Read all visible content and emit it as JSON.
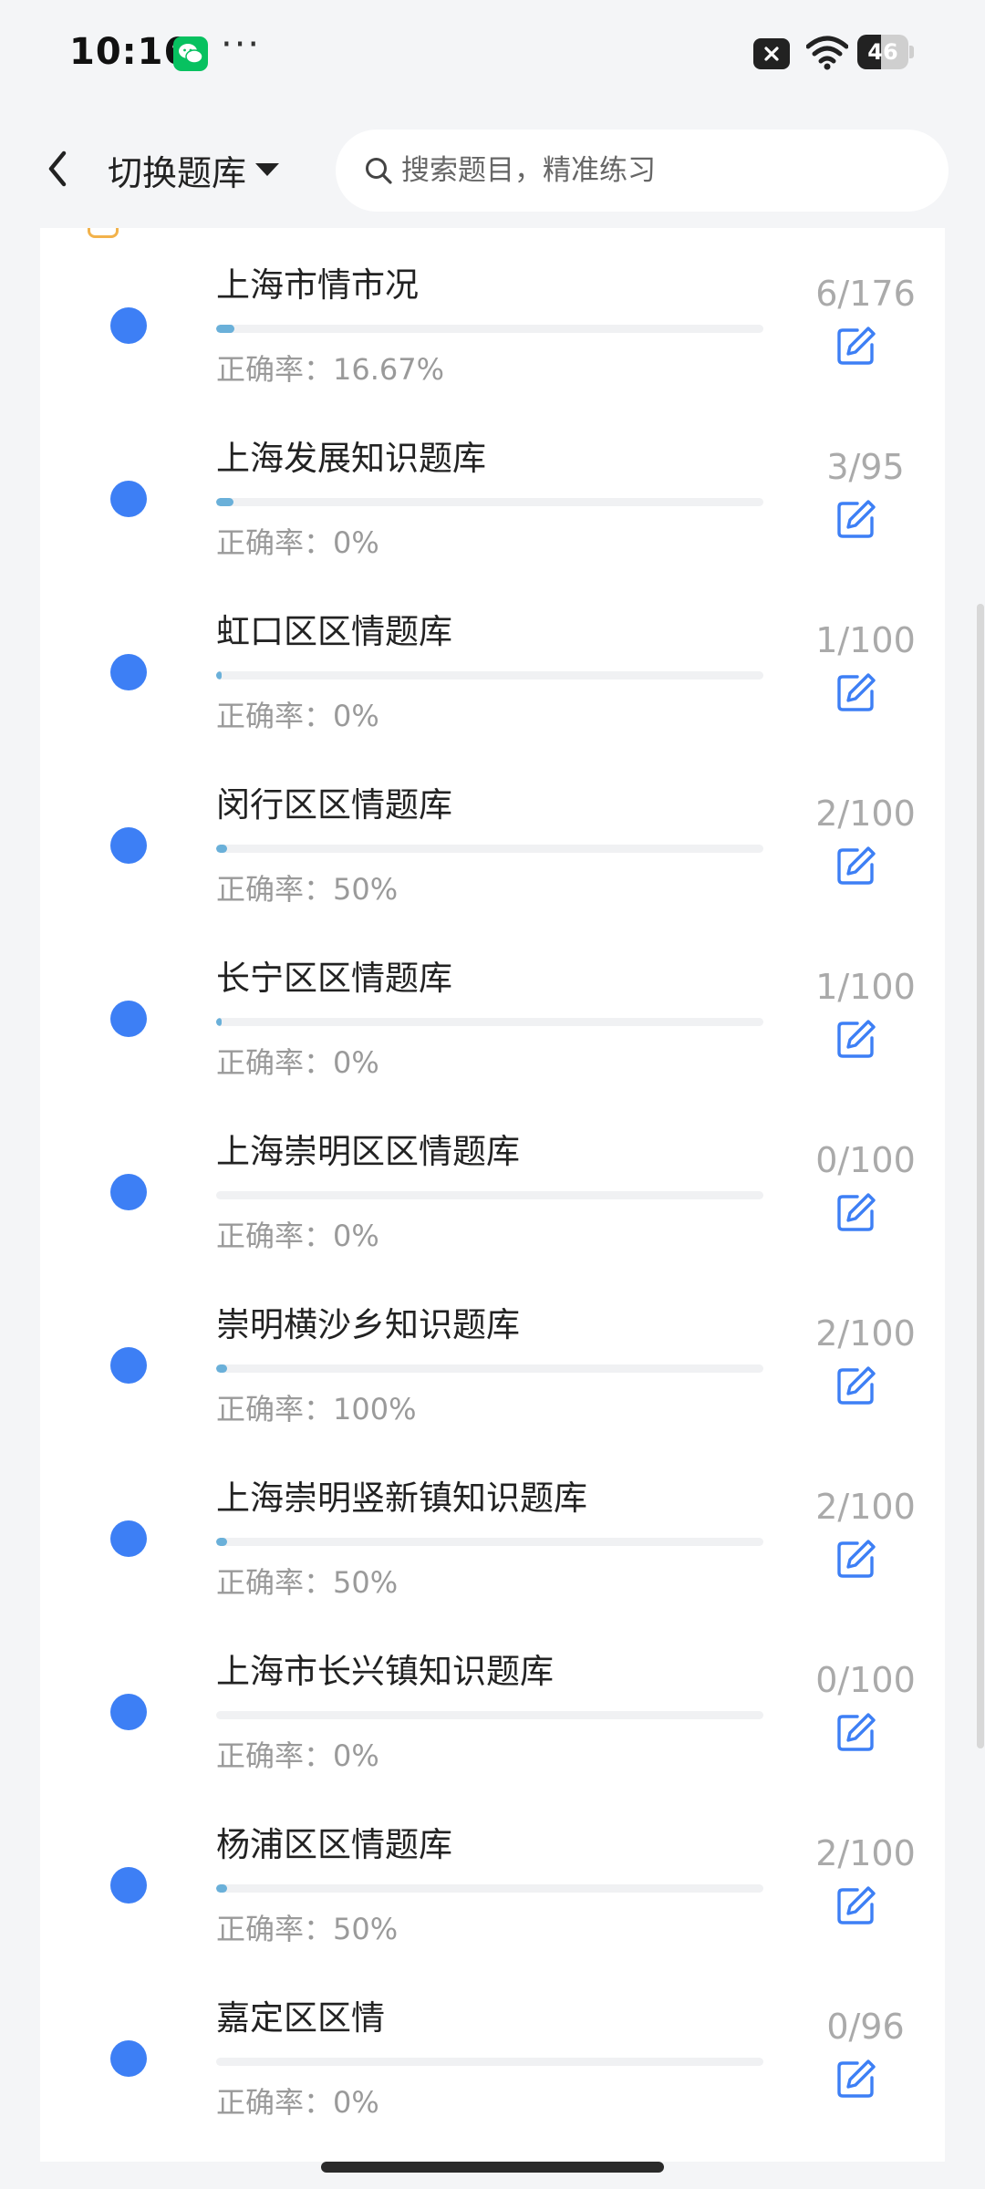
{
  "status_bar": {
    "time": "10:16",
    "overflow": "···",
    "battery": "46",
    "battery_level": 0.46,
    "icons": [
      "wechat-icon",
      "close-notification-icon",
      "wifi-icon",
      "battery-icon"
    ]
  },
  "header": {
    "switch_label": "切换题库",
    "search_placeholder": "搜索题目，精准练习"
  },
  "colors": {
    "accent": "#3d7ff5",
    "progress": "#6ab0d9",
    "wechat": "#07c160",
    "muted": "#9a9a9a"
  },
  "list": {
    "accuracy_label": "正确率：",
    "items": [
      {
        "title": "上海市情市况",
        "accuracy": "16.67%",
        "count": "6/176",
        "progress": 0.034
      },
      {
        "title": "上海发展知识题库",
        "accuracy": "0%",
        "count": "3/95",
        "progress": 0.032
      },
      {
        "title": "虹口区区情题库",
        "accuracy": "0%",
        "count": "1/100",
        "progress": 0.01
      },
      {
        "title": "闵行区区情题库",
        "accuracy": "50%",
        "count": "2/100",
        "progress": 0.02
      },
      {
        "title": "长宁区区情题库",
        "accuracy": "0%",
        "count": "1/100",
        "progress": 0.01
      },
      {
        "title": "上海崇明区区情题库",
        "accuracy": "0%",
        "count": "0/100",
        "progress": 0
      },
      {
        "title": "崇明横沙乡知识题库",
        "accuracy": "100%",
        "count": "2/100",
        "progress": 0.02
      },
      {
        "title": "上海崇明竖新镇知识题库",
        "accuracy": "50%",
        "count": "2/100",
        "progress": 0.02
      },
      {
        "title": "上海市长兴镇知识题库",
        "accuracy": "0%",
        "count": "0/100",
        "progress": 0
      },
      {
        "title": "杨浦区区情题库",
        "accuracy": "50%",
        "count": "2/100",
        "progress": 0.02
      },
      {
        "title": "嘉定区区情",
        "accuracy": "0%",
        "count": "0/96",
        "progress": 0
      }
    ]
  }
}
